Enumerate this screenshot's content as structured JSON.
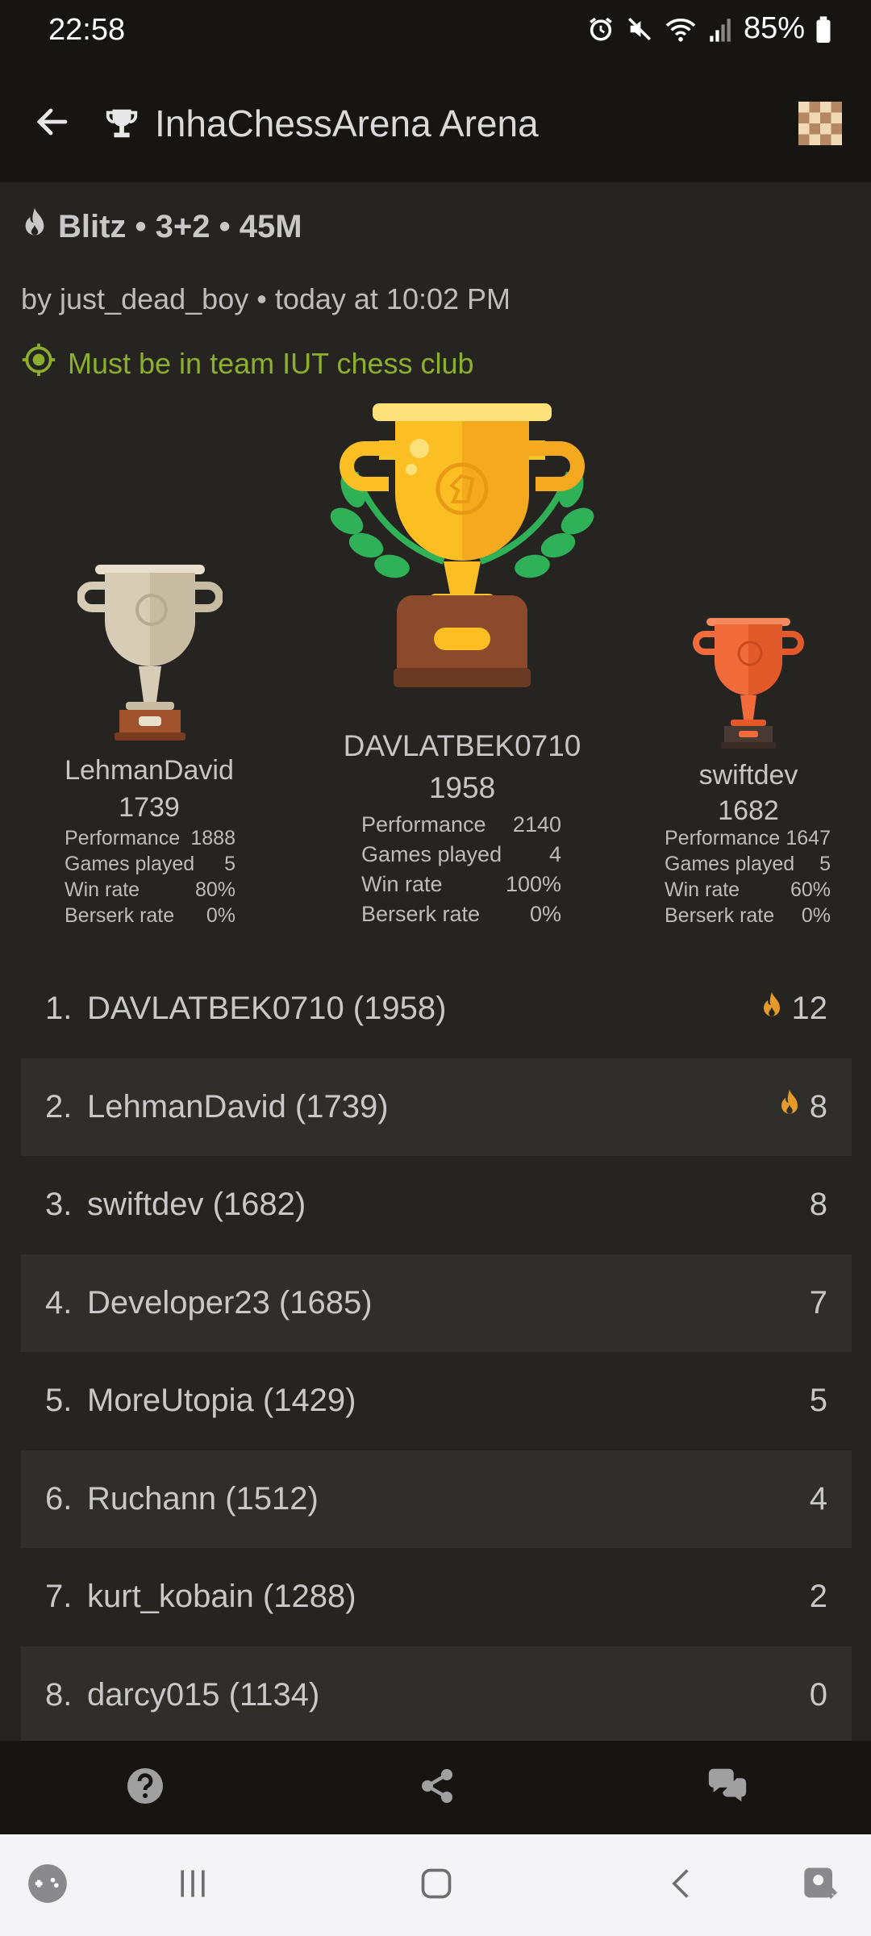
{
  "status_bar": {
    "time": "22:58",
    "battery": "85%"
  },
  "app_bar": {
    "title": "InhaChessArena Arena"
  },
  "header": {
    "format": "Blitz • 3+2 • 45M",
    "created_by": "by just_dead_boy • today at 10:02 PM",
    "condition": "Must be in team IUT chess club"
  },
  "podium": {
    "labels": {
      "performance": "Performance",
      "games": "Games played",
      "win_rate": "Win rate",
      "berserk": "Berserk rate"
    },
    "first": {
      "name": "DAVLATBEK0710",
      "rating": "1958",
      "performance": "2140",
      "games": "4",
      "win_rate": "100%",
      "berserk": "0%"
    },
    "second": {
      "name": "LehmanDavid",
      "rating": "1739",
      "performance": "1888",
      "games": "5",
      "win_rate": "80%",
      "berserk": "0%"
    },
    "third": {
      "name": "swiftdev",
      "rating": "1682",
      "performance": "1647",
      "games": "5",
      "win_rate": "60%",
      "berserk": "0%"
    }
  },
  "ranking": [
    {
      "pos": "1.",
      "name": "DAVLATBEK0710 (1958)",
      "score": "12",
      "fire": true
    },
    {
      "pos": "2.",
      "name": "LehmanDavid (1739)",
      "score": "8",
      "fire": true
    },
    {
      "pos": "3.",
      "name": "swiftdev (1682)",
      "score": "8",
      "fire": false
    },
    {
      "pos": "4.",
      "name": "Developer23 (1685)",
      "score": "7",
      "fire": false
    },
    {
      "pos": "5.",
      "name": "MoreUtopia (1429)",
      "score": "5",
      "fire": false
    },
    {
      "pos": "6.",
      "name": "Ruchann (1512)",
      "score": "4",
      "fire": false
    },
    {
      "pos": "7.",
      "name": "kurt_kobain (1288)",
      "score": "2",
      "fire": false
    },
    {
      "pos": "8.",
      "name": "darcy015 (1134)",
      "score": "0",
      "fire": false
    }
  ],
  "icons": {
    "back": "arrow-left-icon",
    "trophy": "trophy-icon",
    "board": "chessboard-icon",
    "flame": "flame-icon",
    "target": "target-icon",
    "help": "question-circle-icon",
    "share": "share-icon",
    "chat": "chat-icon"
  },
  "colors": {
    "background": "#262421",
    "bar": "#161512",
    "alt_row": "#302e2b",
    "condition": "#8cb02b",
    "flame": "#e69a28"
  }
}
